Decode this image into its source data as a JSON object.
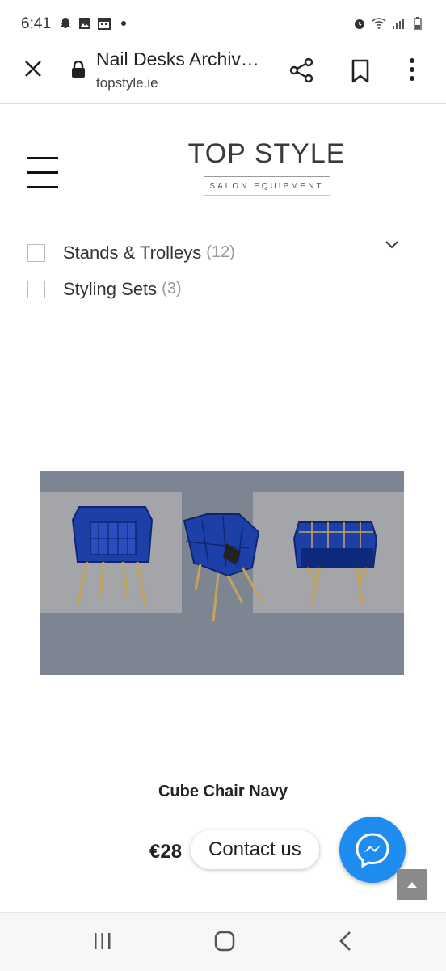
{
  "status_bar": {
    "time": "6:41",
    "left_icons": [
      "snapchat-icon",
      "gallery-icon",
      "calendar-icon",
      "notification-dot"
    ],
    "right_icons": [
      "alarm-icon",
      "wifi-icon",
      "signal-icon",
      "battery-icon"
    ]
  },
  "browser": {
    "title": "Nail Desks Archiv…",
    "url": "topstyle.ie"
  },
  "logo": {
    "main": "TOP STYLE",
    "sub": "SALON EQUIPMENT"
  },
  "filters": [
    {
      "label": "Stands & Trolleys",
      "count": "(12)"
    },
    {
      "label": "Styling Sets",
      "count": "(3)"
    }
  ],
  "product": {
    "name": "Cube Chair Navy",
    "price": "€28"
  },
  "chat": {
    "label": "Contact us"
  },
  "colors": {
    "messenger": "#1f8cf0",
    "chair": "#1d3fa8",
    "image_bg": "#7d8593"
  }
}
